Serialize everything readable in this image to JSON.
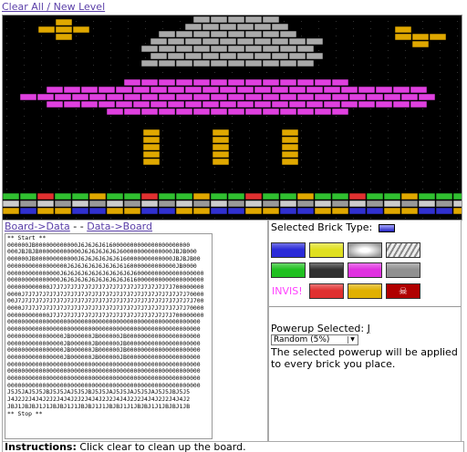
{
  "top_link": "Clear All / New Level",
  "board_links": {
    "board_to_data": "Board->Data",
    "separator": " - - ",
    "data_to_board": "Data->Board"
  },
  "data_text": "** Start **\n000000JB000000000000J6J6J6J6160000000000000000000000\n000JBJBJB000000000000J6J6J6J6J6J600000000000000JBJB000\n000000JB000000000000J6J6J6J6J6J6160000000000000JBJBJB00\n00000000000000000J6J6J6J6J6J6J6J6160000000000000JB0000\n000000000000000J6J6J6J6J6J6J6J6J6J6J60000000000000000000\n000000000000000J6J6J6J6J6J6J6J6J6J6160000000000000000000\n000000000000J7J7J7J7J7J7J7J7J7J7J7J7J7J7J7J7J7J700000000\n0000J7J7J7J7J7J7J7J7J7J7J7J7J7J7J7J7J7J7J7J7J7J7J7J70000\n00J7J7J7J7J7J7J7J7J7J7J7J7J7J7J7J7J7J7J7J7J7J7J7J7J7J700\n0000J7J7J7J7J7J7J7J7J7J7J7J7J7J7J7J7J7J7J7J7J7J7J7J70000\n000000000000J7J7J7J7J7J7J7J7J7J7J7J7J7J7J7J7J7J700000000\n0000000000000000000000000000000000000000000000000000000\n0000000000000000000000000000000000000000000000000000000\n0000000000000000JB000000JB000000JB000000000000000000000\n0000000000000000JB000000JB000000JB000000000000000000000\n0000000000000000JB000000JB000000JB000000000000000000000\n0000000000000000JB000000JB000000JB000000000000000000000\n0000000000000000000000000000000000000000000000000000000\n0000000000000000000000000000000000000000000000000000000\n0000000000000000000000000000000000000000000000000000000\n0000000000000000000000000000000000000000000000000000000\nJ5J5JAJ5J5JBJ5J5JAJ5J5JBJ5J5JAJ5J5JAJ5J5JAJ5J5JBJ5J5\nJ4J2J2J4J4J2J2J4J4J2J2J4J4J2J2J4J4J2J2J4J4J2J2J4J4J2\nJBJ1JBJBJ1J1JBJBJ1J1JBJBJ1J1JBJBJ1J1JBJBJ1J1JBJBJ1JB\n** Stop **",
  "selected_brick": {
    "label": "Selected Brick Type: ",
    "color": "#3030d0"
  },
  "bricks": [
    {
      "name": "blue",
      "color": "#2a2ad8"
    },
    {
      "name": "yellow",
      "color": "#e0e020"
    },
    {
      "name": "gray-textured",
      "color": "#b0b0b0"
    },
    {
      "name": "striped",
      "color": "#c8c8c8"
    },
    {
      "name": "green",
      "color": "#20c020"
    },
    {
      "name": "dark-gray",
      "color": "#303030"
    },
    {
      "name": "magenta",
      "color": "#e030e0"
    },
    {
      "name": "silver",
      "color": "#909090"
    },
    {
      "name": "invisible",
      "label": "INVIS!",
      "color": "#ff40ff"
    },
    {
      "name": "red",
      "color": "#e03030"
    },
    {
      "name": "gold",
      "color": "#e0b000"
    },
    {
      "name": "skull",
      "color": "#c00000"
    }
  ],
  "powerup": {
    "label": "Powerup Selected: ",
    "value": "J",
    "select_value": "Random (5%)",
    "description": "The selected powerup will be applied to every brick you place."
  },
  "instructions": {
    "label": "Instructions:",
    "text": " Click clear to clean up the board."
  }
}
